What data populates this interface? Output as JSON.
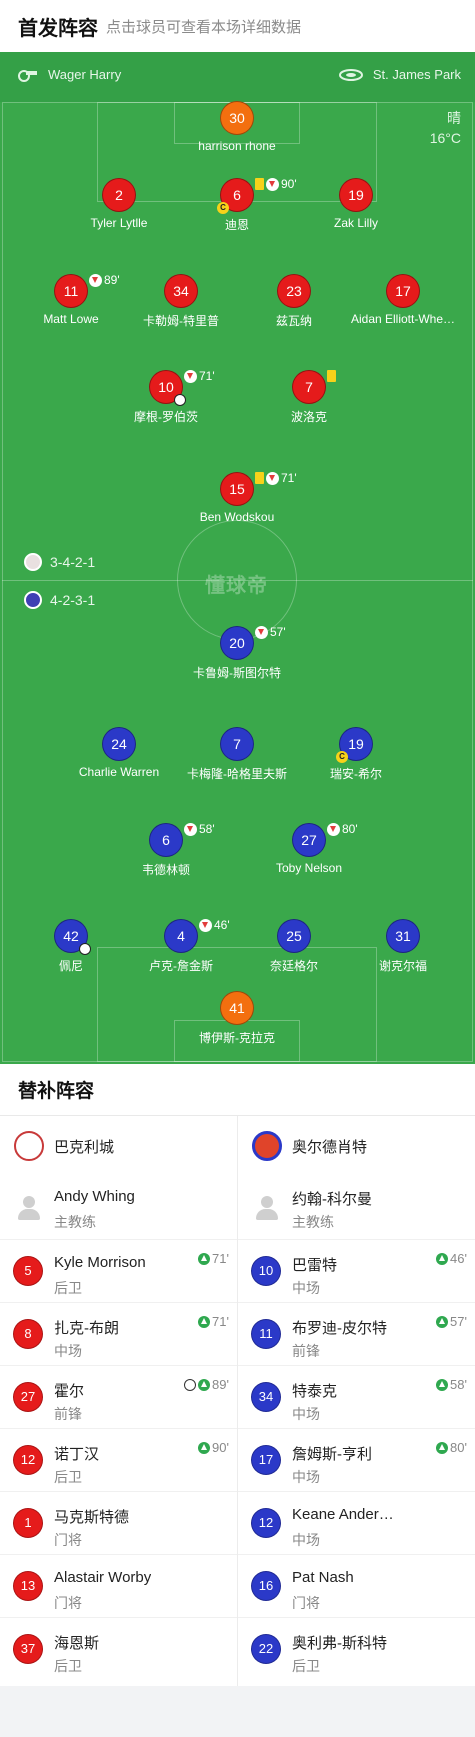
{
  "header": {
    "title": "首发阵容",
    "subtitle": "点击球员可查看本场详细数据"
  },
  "match": {
    "referee": "Wager Harry",
    "stadium": "St. James Park",
    "weather": "晴",
    "temperature": "16°C"
  },
  "formations": {
    "home": "3-4-2-1",
    "away": "4-2-3-1"
  },
  "watermark": "懂球帝",
  "pitch": {
    "home": {
      "gk": {
        "num": "30",
        "name": "harrison rhone"
      },
      "def": [
        {
          "num": "2",
          "name": "Tyler Lytlle"
        },
        {
          "num": "6",
          "name": "迪恩",
          "event": "90'"
        },
        {
          "num": "19",
          "name": "Zak Lilly"
        }
      ],
      "mid": [
        {
          "num": "11",
          "name": "Matt Lowe",
          "event": "89'"
        },
        {
          "num": "34",
          "name": "卡勒姆-特里普"
        },
        {
          "num": "23",
          "name": "兹瓦纳"
        },
        {
          "num": "17",
          "name": "Aidan Elliott-Whe…"
        }
      ],
      "am": [
        {
          "num": "10",
          "name": "摩根-罗伯茨",
          "event": "71'"
        },
        {
          "num": "7",
          "name": "波洛克"
        }
      ],
      "st": {
        "num": "15",
        "name": "Ben Wodskou",
        "event": "71'"
      }
    },
    "away": {
      "st": {
        "num": "20",
        "name": "卡鲁姆-斯图尔特",
        "event": "57'"
      },
      "am": [
        {
          "num": "24",
          "name": "Charlie Warren"
        },
        {
          "num": "7",
          "name": "卡梅隆-哈格里夫斯"
        },
        {
          "num": "19",
          "name": "瑞安-希尔"
        }
      ],
      "dm": [
        {
          "num": "6",
          "name": "韦德林顿",
          "event": "58'"
        },
        {
          "num": "27",
          "name": "Toby Nelson",
          "event": "80'"
        }
      ],
      "def": [
        {
          "num": "42",
          "name": "佩尼"
        },
        {
          "num": "4",
          "name": "卢克-詹金斯",
          "event": "46'"
        },
        {
          "num": "25",
          "name": "奈廷格尔"
        },
        {
          "num": "31",
          "name": "谢克尔福"
        }
      ],
      "gk": {
        "num": "41",
        "name": "博伊斯-克拉克"
      }
    }
  },
  "subs": {
    "title": "替补阵容",
    "home": {
      "team": "巴克利城",
      "coach": {
        "name": "Andy Whing",
        "role": "主教练"
      },
      "players": [
        {
          "num": "5",
          "name": "Kyle Morrison",
          "pos": "后卫",
          "event": "71'"
        },
        {
          "num": "8",
          "name": "扎克-布朗",
          "pos": "中场",
          "event": "71'"
        },
        {
          "num": "27",
          "name": "霍尔",
          "pos": "前锋",
          "event": "89'"
        },
        {
          "num": "12",
          "name": "诺丁汉",
          "pos": "后卫",
          "event": "90'"
        },
        {
          "num": "1",
          "name": "马克斯特德",
          "pos": "门将"
        },
        {
          "num": "13",
          "name": "Alastair Worby",
          "pos": "门将"
        },
        {
          "num": "37",
          "name": "海恩斯",
          "pos": "后卫"
        }
      ]
    },
    "away": {
      "team": "奥尔德肖特",
      "coach": {
        "name": "约翰-科尔曼",
        "role": "主教练"
      },
      "players": [
        {
          "num": "10",
          "name": "巴雷特",
          "pos": "中场",
          "event": "46'"
        },
        {
          "num": "11",
          "name": "布罗迪-皮尔特",
          "pos": "前锋",
          "event": "57'"
        },
        {
          "num": "34",
          "name": "特泰克",
          "pos": "中场",
          "event": "58'"
        },
        {
          "num": "17",
          "name": "詹姆斯-亨利",
          "pos": "中场",
          "event": "80'"
        },
        {
          "num": "12",
          "name": "Keane Ander…",
          "pos": "中场"
        },
        {
          "num": "16",
          "name": "Pat Nash",
          "pos": "门将"
        },
        {
          "num": "22",
          "name": "奥利弗-斯科特",
          "pos": "后卫"
        }
      ]
    }
  },
  "colors": {
    "pitch": "#3aa84b",
    "home": "#e51b1b",
    "away": "#2b39c8",
    "gk": "#f36f0f",
    "yellow_card": "#f7d21a",
    "sub_in": "#2fa84f"
  }
}
